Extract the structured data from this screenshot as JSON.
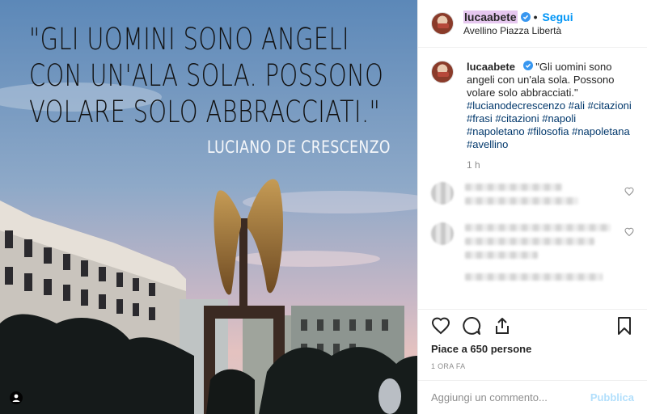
{
  "photo": {
    "quote_lines": [
      "\"GLI UOMINI SONO ANGELI",
      "CON UN'ALA SOLA. POSSONO",
      "VOLARE SOLO ABBRACCIATI.\""
    ],
    "author": "LUCIANO DE CRESCENZO"
  },
  "header": {
    "username": "lucaabete",
    "separator": "•",
    "follow_label": "Segui",
    "location": "Avellino Piazza Libertà"
  },
  "caption": {
    "username": "lucaabete",
    "text": "\"Gli uomini sono angeli con un'ala sola. Possono volare solo abbracciati.\"",
    "hashtags": "#lucianodecrescenzo #ali #citazioni #frasi #citazioni #napoli #napoletano #filosofia #napoletana #avellino",
    "time": "1 h"
  },
  "likes": "Piace a 650 persone",
  "posted": "1 ORA FA",
  "comment_box": {
    "placeholder": "Aggiungi un commento...",
    "publish_label": "Pubblica"
  },
  "colors": {
    "accent": "#0095f6",
    "hashtag": "#00376b",
    "muted": "#8e8e8e",
    "username_highlight": "#e6c7ef"
  },
  "icons": [
    "verified-badge-icon",
    "heart-icon",
    "comment-icon",
    "share-icon",
    "bookmark-icon",
    "user-tag-icon"
  ]
}
